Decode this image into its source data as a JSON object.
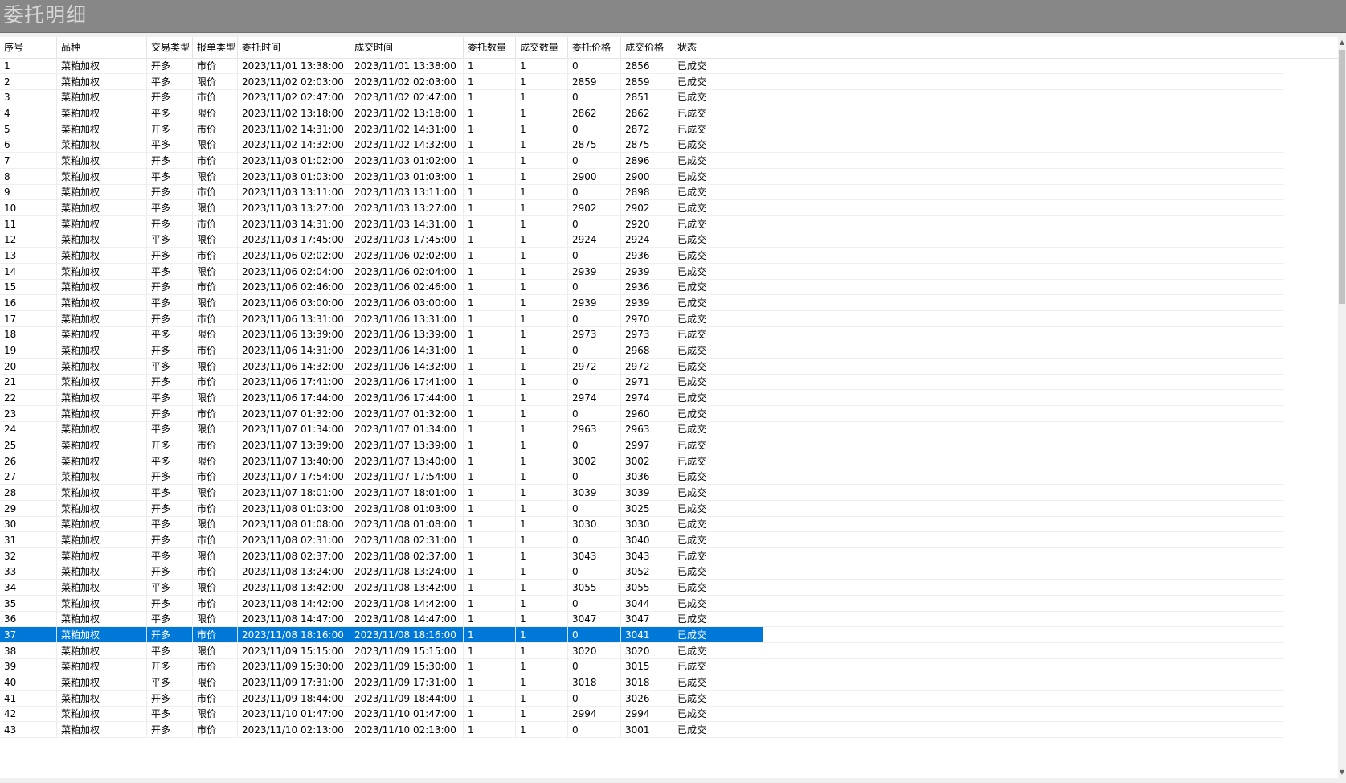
{
  "window": {
    "title": "委托明细"
  },
  "table": {
    "columns": [
      "序号",
      "品种",
      "交易类型",
      "报单类型",
      "委托时间",
      "成交时间",
      "委托数量",
      "成交数量",
      "委托价格",
      "成交价格",
      "状态"
    ],
    "selected_row": 37,
    "rows": [
      [
        "1",
        "菜粕加权",
        "开多",
        "市价",
        "2023/11/01 13:38:00",
        "2023/11/01 13:38:00",
        "1",
        "1",
        "0",
        "2856",
        "已成交"
      ],
      [
        "2",
        "菜粕加权",
        "平多",
        "限价",
        "2023/11/02 02:03:00",
        "2023/11/02 02:03:00",
        "1",
        "1",
        "2859",
        "2859",
        "已成交"
      ],
      [
        "3",
        "菜粕加权",
        "开多",
        "市价",
        "2023/11/02 02:47:00",
        "2023/11/02 02:47:00",
        "1",
        "1",
        "0",
        "2851",
        "已成交"
      ],
      [
        "4",
        "菜粕加权",
        "平多",
        "限价",
        "2023/11/02 13:18:00",
        "2023/11/02 13:18:00",
        "1",
        "1",
        "2862",
        "2862",
        "已成交"
      ],
      [
        "5",
        "菜粕加权",
        "开多",
        "市价",
        "2023/11/02 14:31:00",
        "2023/11/02 14:31:00",
        "1",
        "1",
        "0",
        "2872",
        "已成交"
      ],
      [
        "6",
        "菜粕加权",
        "平多",
        "限价",
        "2023/11/02 14:32:00",
        "2023/11/02 14:32:00",
        "1",
        "1",
        "2875",
        "2875",
        "已成交"
      ],
      [
        "7",
        "菜粕加权",
        "开多",
        "市价",
        "2023/11/03 01:02:00",
        "2023/11/03 01:02:00",
        "1",
        "1",
        "0",
        "2896",
        "已成交"
      ],
      [
        "8",
        "菜粕加权",
        "平多",
        "限价",
        "2023/11/03 01:03:00",
        "2023/11/03 01:03:00",
        "1",
        "1",
        "2900",
        "2900",
        "已成交"
      ],
      [
        "9",
        "菜粕加权",
        "开多",
        "市价",
        "2023/11/03 13:11:00",
        "2023/11/03 13:11:00",
        "1",
        "1",
        "0",
        "2898",
        "已成交"
      ],
      [
        "10",
        "菜粕加权",
        "平多",
        "限价",
        "2023/11/03 13:27:00",
        "2023/11/03 13:27:00",
        "1",
        "1",
        "2902",
        "2902",
        "已成交"
      ],
      [
        "11",
        "菜粕加权",
        "开多",
        "市价",
        "2023/11/03 14:31:00",
        "2023/11/03 14:31:00",
        "1",
        "1",
        "0",
        "2920",
        "已成交"
      ],
      [
        "12",
        "菜粕加权",
        "平多",
        "限价",
        "2023/11/03 17:45:00",
        "2023/11/03 17:45:00",
        "1",
        "1",
        "2924",
        "2924",
        "已成交"
      ],
      [
        "13",
        "菜粕加权",
        "开多",
        "市价",
        "2023/11/06 02:02:00",
        "2023/11/06 02:02:00",
        "1",
        "1",
        "0",
        "2936",
        "已成交"
      ],
      [
        "14",
        "菜粕加权",
        "平多",
        "限价",
        "2023/11/06 02:04:00",
        "2023/11/06 02:04:00",
        "1",
        "1",
        "2939",
        "2939",
        "已成交"
      ],
      [
        "15",
        "菜粕加权",
        "开多",
        "市价",
        "2023/11/06 02:46:00",
        "2023/11/06 02:46:00",
        "1",
        "1",
        "0",
        "2936",
        "已成交"
      ],
      [
        "16",
        "菜粕加权",
        "平多",
        "限价",
        "2023/11/06 03:00:00",
        "2023/11/06 03:00:00",
        "1",
        "1",
        "2939",
        "2939",
        "已成交"
      ],
      [
        "17",
        "菜粕加权",
        "开多",
        "市价",
        "2023/11/06 13:31:00",
        "2023/11/06 13:31:00",
        "1",
        "1",
        "0",
        "2970",
        "已成交"
      ],
      [
        "18",
        "菜粕加权",
        "平多",
        "限价",
        "2023/11/06 13:39:00",
        "2023/11/06 13:39:00",
        "1",
        "1",
        "2973",
        "2973",
        "已成交"
      ],
      [
        "19",
        "菜粕加权",
        "开多",
        "市价",
        "2023/11/06 14:31:00",
        "2023/11/06 14:31:00",
        "1",
        "1",
        "0",
        "2968",
        "已成交"
      ],
      [
        "20",
        "菜粕加权",
        "平多",
        "限价",
        "2023/11/06 14:32:00",
        "2023/11/06 14:32:00",
        "1",
        "1",
        "2972",
        "2972",
        "已成交"
      ],
      [
        "21",
        "菜粕加权",
        "开多",
        "市价",
        "2023/11/06 17:41:00",
        "2023/11/06 17:41:00",
        "1",
        "1",
        "0",
        "2971",
        "已成交"
      ],
      [
        "22",
        "菜粕加权",
        "平多",
        "限价",
        "2023/11/06 17:44:00",
        "2023/11/06 17:44:00",
        "1",
        "1",
        "2974",
        "2974",
        "已成交"
      ],
      [
        "23",
        "菜粕加权",
        "开多",
        "市价",
        "2023/11/07 01:32:00",
        "2023/11/07 01:32:00",
        "1",
        "1",
        "0",
        "2960",
        "已成交"
      ],
      [
        "24",
        "菜粕加权",
        "平多",
        "限价",
        "2023/11/07 01:34:00",
        "2023/11/07 01:34:00",
        "1",
        "1",
        "2963",
        "2963",
        "已成交"
      ],
      [
        "25",
        "菜粕加权",
        "开多",
        "市价",
        "2023/11/07 13:39:00",
        "2023/11/07 13:39:00",
        "1",
        "1",
        "0",
        "2997",
        "已成交"
      ],
      [
        "26",
        "菜粕加权",
        "平多",
        "限价",
        "2023/11/07 13:40:00",
        "2023/11/07 13:40:00",
        "1",
        "1",
        "3002",
        "3002",
        "已成交"
      ],
      [
        "27",
        "菜粕加权",
        "开多",
        "市价",
        "2023/11/07 17:54:00",
        "2023/11/07 17:54:00",
        "1",
        "1",
        "0",
        "3036",
        "已成交"
      ],
      [
        "28",
        "菜粕加权",
        "平多",
        "限价",
        "2023/11/07 18:01:00",
        "2023/11/07 18:01:00",
        "1",
        "1",
        "3039",
        "3039",
        "已成交"
      ],
      [
        "29",
        "菜粕加权",
        "开多",
        "市价",
        "2023/11/08 01:03:00",
        "2023/11/08 01:03:00",
        "1",
        "1",
        "0",
        "3025",
        "已成交"
      ],
      [
        "30",
        "菜粕加权",
        "平多",
        "限价",
        "2023/11/08 01:08:00",
        "2023/11/08 01:08:00",
        "1",
        "1",
        "3030",
        "3030",
        "已成交"
      ],
      [
        "31",
        "菜粕加权",
        "开多",
        "市价",
        "2023/11/08 02:31:00",
        "2023/11/08 02:31:00",
        "1",
        "1",
        "0",
        "3040",
        "已成交"
      ],
      [
        "32",
        "菜粕加权",
        "平多",
        "限价",
        "2023/11/08 02:37:00",
        "2023/11/08 02:37:00",
        "1",
        "1",
        "3043",
        "3043",
        "已成交"
      ],
      [
        "33",
        "菜粕加权",
        "开多",
        "市价",
        "2023/11/08 13:24:00",
        "2023/11/08 13:24:00",
        "1",
        "1",
        "0",
        "3052",
        "已成交"
      ],
      [
        "34",
        "菜粕加权",
        "平多",
        "限价",
        "2023/11/08 13:42:00",
        "2023/11/08 13:42:00",
        "1",
        "1",
        "3055",
        "3055",
        "已成交"
      ],
      [
        "35",
        "菜粕加权",
        "开多",
        "市价",
        "2023/11/08 14:42:00",
        "2023/11/08 14:42:00",
        "1",
        "1",
        "0",
        "3044",
        "已成交"
      ],
      [
        "36",
        "菜粕加权",
        "平多",
        "限价",
        "2023/11/08 14:47:00",
        "2023/11/08 14:47:00",
        "1",
        "1",
        "3047",
        "3047",
        "已成交"
      ],
      [
        "37",
        "菜粕加权",
        "开多",
        "市价",
        "2023/11/08 18:16:00",
        "2023/11/08 18:16:00",
        "1",
        "1",
        "0",
        "3041",
        "已成交"
      ],
      [
        "38",
        "菜粕加权",
        "平多",
        "限价",
        "2023/11/09 15:15:00",
        "2023/11/09 15:15:00",
        "1",
        "1",
        "3020",
        "3020",
        "已成交"
      ],
      [
        "39",
        "菜粕加权",
        "开多",
        "市价",
        "2023/11/09 15:30:00",
        "2023/11/09 15:30:00",
        "1",
        "1",
        "0",
        "3015",
        "已成交"
      ],
      [
        "40",
        "菜粕加权",
        "平多",
        "限价",
        "2023/11/09 17:31:00",
        "2023/11/09 17:31:00",
        "1",
        "1",
        "3018",
        "3018",
        "已成交"
      ],
      [
        "41",
        "菜粕加权",
        "开多",
        "市价",
        "2023/11/09 18:44:00",
        "2023/11/09 18:44:00",
        "1",
        "1",
        "0",
        "3026",
        "已成交"
      ],
      [
        "42",
        "菜粕加权",
        "平多",
        "限价",
        "2023/11/10 01:47:00",
        "2023/11/10 01:47:00",
        "1",
        "1",
        "2994",
        "2994",
        "已成交"
      ],
      [
        "43",
        "菜粕加权",
        "开多",
        "市价",
        "2023/11/10 02:13:00",
        "2023/11/10 02:13:00",
        "1",
        "1",
        "0",
        "3001",
        "已成交"
      ]
    ]
  },
  "scrollbar": {
    "up_icon": "▲",
    "down_icon": "▼"
  },
  "colors": {
    "titlebar": "#878787",
    "selection": "#0078d7"
  }
}
